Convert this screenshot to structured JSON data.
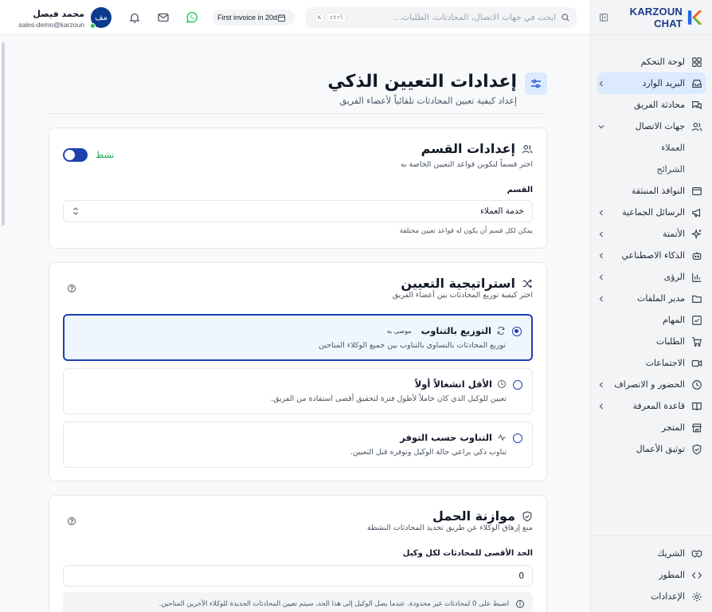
{
  "brand": {
    "name": "KARZOUN CHAT"
  },
  "topbar": {
    "search_placeholder": "ابحث في جهات الاتصال، المحادثات، الطلبات...",
    "kbd_ctrl": "ctrl",
    "kbd_k": "K",
    "invoice_label": "First invoice in 20d",
    "user": {
      "name": "محمد فيصل",
      "email": "sales-demo@karzoun...",
      "initials": "مف"
    }
  },
  "sidebar": {
    "items": [
      {
        "label": "لوحة التحكم",
        "icon": "dashboard-icon"
      },
      {
        "label": "البريد الوارد",
        "icon": "inbox-icon",
        "active": true
      },
      {
        "label": "محادثة الفريق",
        "icon": "team-chat-icon"
      },
      {
        "label": "جهات الاتصال",
        "icon": "contacts-icon"
      },
      {
        "label": "العملاء",
        "sub": true
      },
      {
        "label": "الشرائح",
        "sub": true
      },
      {
        "label": "النوافذ المنبثقة",
        "icon": "popup-icon"
      },
      {
        "label": "الرسائل الجماعية",
        "icon": "megaphone-icon"
      },
      {
        "label": "الأتمتة",
        "icon": "sparkles-icon"
      },
      {
        "label": "الذكاء الاصطناعي",
        "icon": "bot-icon"
      },
      {
        "label": "الرؤى",
        "icon": "chart-icon"
      },
      {
        "label": "مدير الملفات",
        "icon": "folder-icon"
      },
      {
        "label": "المهام",
        "icon": "tasks-icon"
      },
      {
        "label": "الطلبات",
        "icon": "cart-icon"
      },
      {
        "label": "الاجتماعات",
        "icon": "video-icon"
      },
      {
        "label": "الحضور و الانصراف",
        "icon": "clock-icon"
      },
      {
        "label": "قاعدة المعرفة",
        "icon": "book-icon"
      },
      {
        "label": "المتجر",
        "icon": "store-icon"
      },
      {
        "label": "توثيق الأعمال",
        "icon": "shield-check-icon"
      }
    ],
    "bottom": [
      {
        "label": "الشريك",
        "icon": "handshake-icon"
      },
      {
        "label": "المطور",
        "icon": "code-icon"
      },
      {
        "label": "الإعدادات",
        "icon": "settings-icon"
      }
    ]
  },
  "page": {
    "title": "إعدادات التعيين الذكي",
    "subtitle": "إعداد كيفية تعيين المحادثات تلقائياً لأعضاء الفريق"
  },
  "department": {
    "title": "إعدادات القسم",
    "subtitle": "اختر قسماً لتكوين قواعد التعيين الخاصة به",
    "toggle_label": "نشط",
    "field_label": "القسم",
    "selected": "خدمة العملاء",
    "hint": "يمكن لكل قسم أن يكون له قواعد تعيين مختلفة"
  },
  "strategy": {
    "title": "استراتيجية التعيين",
    "subtitle": "اختر كيفية توزيع المحادثات بين أعضاء الفريق",
    "options": [
      {
        "title": "التوزيع بالتناوب",
        "badge": "موصى به",
        "desc": "توزيع المحادثات بالتساوي بالتناوب بين جميع الوكلاء المتاحين",
        "selected": true
      },
      {
        "title": "الأقل انشغالاً أولاً",
        "desc": "تعيين للوكيل الذي كان خاملاً لأطول فترة لتحقيق أقصى استفادة من الفريق.",
        "selected": false
      },
      {
        "title": "التناوب حسب التوفر",
        "desc": "تناوب ذكي يراعي حالة الوكيل وتوفره قبل التعيين.",
        "selected": false
      }
    ]
  },
  "load": {
    "title": "موازنة الحمل",
    "subtitle": "منع إرهاق الوكلاء عن طريق تحديد المحادثات النشطة",
    "field_label": "الحد الأقصى للمحادثات لكل وكيل",
    "value": "0",
    "info": "اضبط على 0 لمحادثات غير محدودة. عندما يصل الوكيل إلى هذا الحد، سيتم تعيين المحادثات الجديدة للوكلاء الآخرين المتاحين."
  }
}
